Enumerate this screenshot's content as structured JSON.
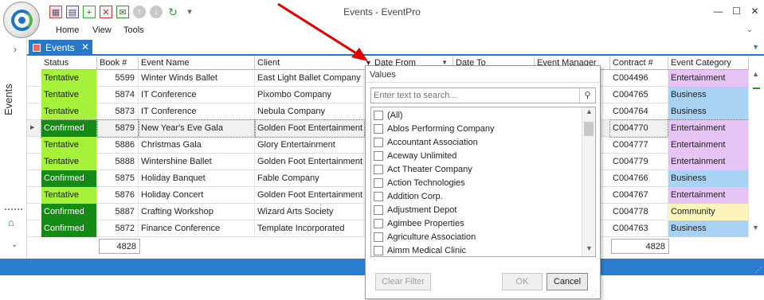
{
  "app": {
    "title": "Events - EventPro",
    "menu": [
      "Home",
      "View",
      "Tools"
    ]
  },
  "leftnav": {
    "label": "Events"
  },
  "tab": {
    "label": "Events"
  },
  "columns": [
    "Status",
    "Book #",
    "Event Name",
    "Client",
    "Date From",
    "Date To",
    "Event Manager",
    "Contract #",
    "Event Category"
  ],
  "rows": [
    {
      "status": "Tentative",
      "book": "5599",
      "name": "Winter Winds Ballet",
      "client": "East Light Ballet Company",
      "contract": "C004496",
      "category": "Entertainment"
    },
    {
      "status": "Tentative",
      "book": "5874",
      "name": "IT Conference",
      "client": "Pixombo Company",
      "contract": "C004765",
      "category": "Business"
    },
    {
      "status": "Tentative",
      "book": "5873",
      "name": "IT Conference",
      "client": "Nebula Company",
      "contract": "C004764",
      "category": "Business"
    },
    {
      "status": "Confirmed",
      "book": "5879",
      "name": "New Year's Eve Gala",
      "client": "Golden Foot Entertainment",
      "contract": "C004770",
      "category": "Entertainment"
    },
    {
      "status": "Tentative",
      "book": "5886",
      "name": "Christmas Gala",
      "client": "Glory Entertainment",
      "contract": "C004777",
      "category": "Entertainment"
    },
    {
      "status": "Tentative",
      "book": "5888",
      "name": "Wintershine Ballet",
      "client": "Golden Foot Entertainment",
      "contract": "C004779",
      "category": "Entertainment"
    },
    {
      "status": "Confirmed",
      "book": "5875",
      "name": "Holiday Banquet",
      "client": "Fable Company",
      "contract": "C004766",
      "category": "Business"
    },
    {
      "status": "Tentative",
      "book": "5876",
      "name": "Holiday Concert",
      "client": "Golden Foot Entertainment",
      "contract": "C004767",
      "category": "Entertainment"
    },
    {
      "status": "Confirmed",
      "book": "5887",
      "name": "Crafting Workshop",
      "client": "Wizard Arts Society",
      "contract": "C004778",
      "category": "Community"
    },
    {
      "status": "Confirmed",
      "book": "5872",
      "name": "Finance Conference",
      "client": "Template Incorporated",
      "contract": "C004763",
      "category": "Business"
    }
  ],
  "footer": {
    "book_total": "4828",
    "contract_total": "4828"
  },
  "filter_popup": {
    "title": "Values",
    "search_placeholder": "Enter text to search...",
    "values": [
      "(All)",
      "Ablos Performing Company",
      "Accountant Association",
      "Aceway Unlimited",
      "Act Theater Company",
      "Action Technologies",
      "Addition Corp.",
      "Adjustment Depot",
      "Agimbee Properties",
      "Agriculture Association",
      "Aimm Medical Clinic"
    ],
    "clear_filter": "Clear Filter",
    "ok": "OK",
    "cancel": "Cancel"
  },
  "colors": {
    "accent": "#2b7dd0",
    "tentative": "#a6f13a",
    "confirmed": "#158a15",
    "entertainment": "#e6c4f5",
    "business": "#a9d3f5",
    "community": "#fbf4bb",
    "arrow": "#e00000"
  }
}
